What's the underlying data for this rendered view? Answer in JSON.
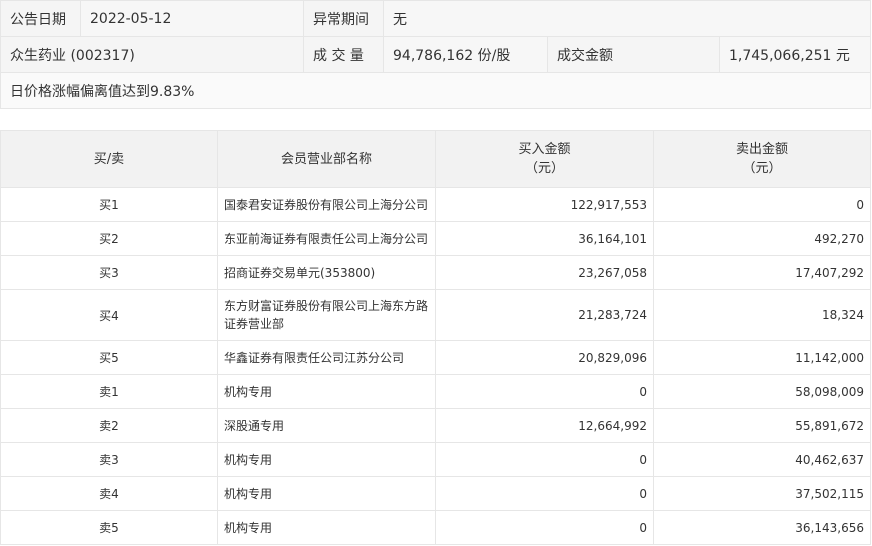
{
  "info": {
    "date_label": "公告日期",
    "date_value": "2022-05-12",
    "period_label": "异常期间",
    "period_value": "无",
    "stock": "众生药业 (002317)",
    "volume_label": "成 交 量",
    "volume_value": "94,786,162 份/股",
    "amount_label": "成交金额",
    "amount_value": "1,745,066,251 元",
    "reason": "日价格涨幅偏离值达到9.83%"
  },
  "detail": {
    "headers": {
      "side": "买/卖",
      "name": "会员营业部名称",
      "buy": "买入金额",
      "sell": "卖出金额",
      "unit": "（元）"
    },
    "rows": [
      {
        "side": "买1",
        "name": "国泰君安证券股份有限公司上海分公司",
        "buy": "122,917,553",
        "sell": "0"
      },
      {
        "side": "买2",
        "name": "东亚前海证券有限责任公司上海分公司",
        "buy": "36,164,101",
        "sell": "492,270"
      },
      {
        "side": "买3",
        "name": "招商证券交易单元(353800)",
        "buy": "23,267,058",
        "sell": "17,407,292"
      },
      {
        "side": "买4",
        "name": "东方财富证券股份有限公司上海东方路证券营业部",
        "buy": "21,283,724",
        "sell": "18,324"
      },
      {
        "side": "买5",
        "name": "华鑫证券有限责任公司江苏分公司",
        "buy": "20,829,096",
        "sell": "11,142,000"
      },
      {
        "side": "卖1",
        "name": "机构专用",
        "buy": "0",
        "sell": "58,098,009"
      },
      {
        "side": "卖2",
        "name": "深股通专用",
        "buy": "12,664,992",
        "sell": "55,891,672"
      },
      {
        "side": "卖3",
        "name": "机构专用",
        "buy": "0",
        "sell": "40,462,637"
      },
      {
        "side": "卖4",
        "name": "机构专用",
        "buy": "0",
        "sell": "37,502,115"
      },
      {
        "side": "卖5",
        "name": "机构专用",
        "buy": "0",
        "sell": "36,143,656"
      }
    ]
  }
}
